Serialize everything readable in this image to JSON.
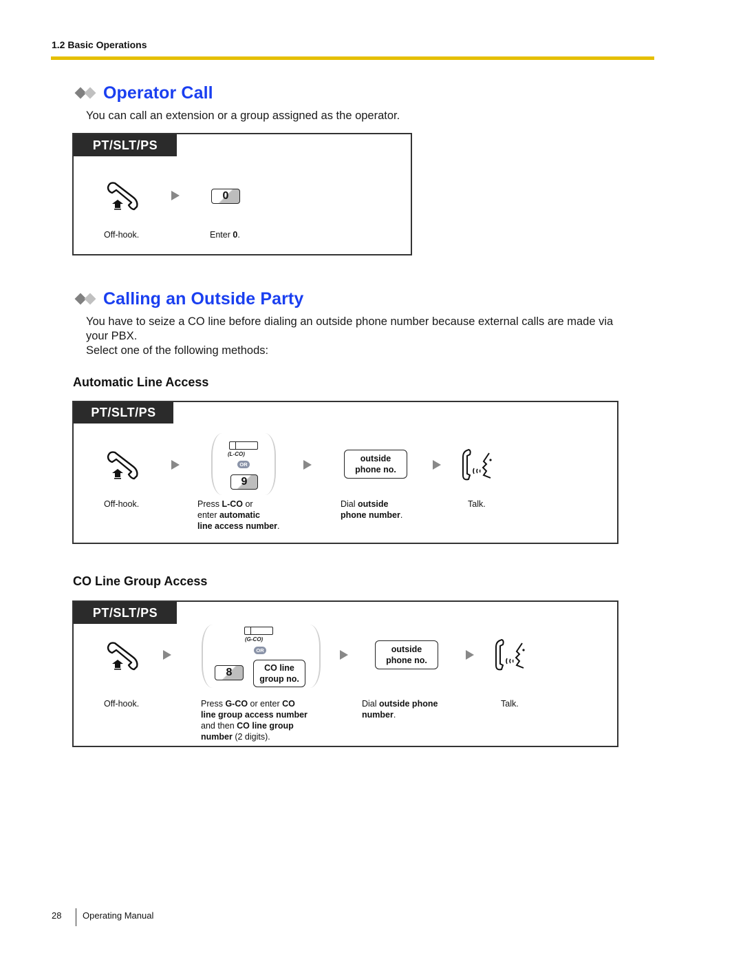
{
  "header": {
    "section": "1.2 Basic Operations",
    "rule_color": "#e5bf00"
  },
  "operator_call": {
    "title": "Operator Call",
    "description": "You can call an extension or a group assigned as the operator.",
    "box": {
      "tag": "PT/SLT/PS",
      "steps": [
        {
          "icon": "off-hook-handset-icon",
          "caption": "Off-hook."
        },
        {
          "key": "0",
          "caption_prefix": "Enter ",
          "caption_bold": "0",
          "caption_suffix": "."
        }
      ]
    }
  },
  "calling_outside": {
    "title": "Calling an Outside Party",
    "description_line1": "You have to seize a CO line before dialing an outside phone number because external calls are made via",
    "description_line2": "your PBX.",
    "description_line3": "Select one of the following methods:",
    "automatic": {
      "subtitle": "Automatic Line Access",
      "tag": "PT/SLT/PS",
      "button_label": "(L-CO)",
      "or_label": "OR",
      "key": "9",
      "dial_box_line1": "outside",
      "dial_box_line2": "phone no.",
      "captions": {
        "offhook": "Off-hook.",
        "press_1a": "Press ",
        "press_1b": "L-CO",
        "press_1c": " or",
        "press_2a": "enter ",
        "press_2b": "automatic",
        "press_3b": "line access number",
        "press_3c": ".",
        "dial_1a": "Dial ",
        "dial_1b": "outside",
        "dial_2b": "phone number",
        "dial_2c": ".",
        "talk": "Talk."
      }
    },
    "group": {
      "subtitle": "CO Line Group Access",
      "tag": "PT/SLT/PS",
      "button_label": "(G-CO)",
      "or_label": "OR",
      "key": "8",
      "group_box_line1": "CO line",
      "group_box_line2": "group no.",
      "dial_box_line1": "outside",
      "dial_box_line2": "phone no.",
      "captions": {
        "offhook": "Off-hook.",
        "press_1a": "Press ",
        "press_1b": "G-CO",
        "press_1c": " or enter ",
        "press_1d": "CO",
        "press_2b": "line group access number",
        "press_3a": "and then ",
        "press_3b": "CO line group",
        "press_4b": "number",
        "press_4c": " (2 digits).",
        "dial_1a": "Dial ",
        "dial_1b": "outside phone",
        "dial_2b": "number",
        "dial_2c": ".",
        "talk": "Talk."
      }
    }
  },
  "footer": {
    "page_number": "28",
    "title": "Operating Manual"
  }
}
